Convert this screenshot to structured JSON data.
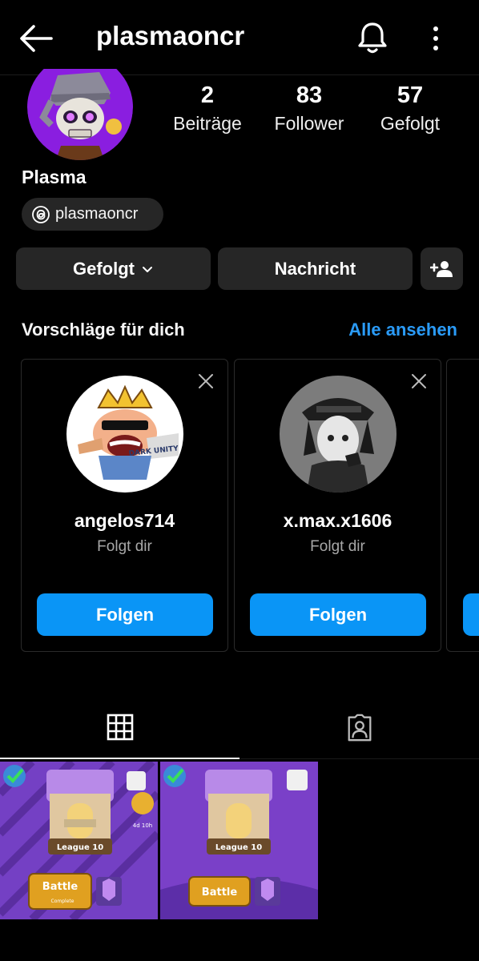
{
  "header": {
    "username": "plasmaoncr",
    "back_icon": "arrow-left-icon",
    "bell_icon": "bell-icon",
    "more_icon": "more-vertical-icon"
  },
  "profile": {
    "display_name": "Plasma",
    "threads_handle": "plasmaoncr",
    "stats": [
      {
        "value": "2",
        "label": "Beiträge"
      },
      {
        "value": "83",
        "label": "Follower"
      },
      {
        "value": "57",
        "label": "Gefolgt"
      }
    ]
  },
  "actions": {
    "following_label": "Gefolgt",
    "message_label": "Nachricht",
    "add_person_icon": "add-person-icon"
  },
  "suggestions": {
    "title": "Vorschläge für dich",
    "see_all": "Alle ansehen",
    "cards": [
      {
        "username": "angelos714",
        "subtitle": "Folgt dir",
        "button": "Folgen",
        "avatar_text": "DARK UNITY"
      },
      {
        "username": "x.max.x1606",
        "subtitle": "Folgt dir",
        "button": "Folgen"
      }
    ]
  },
  "tabs": [
    {
      "icon": "grid-icon",
      "active": true
    },
    {
      "icon": "tagged-person-icon",
      "active": false
    }
  ],
  "posts": [
    {
      "league": "League 10",
      "battle": "Battle",
      "complete": "Complete",
      "timer": "4d 10h"
    },
    {
      "league": "League 10",
      "battle": "Battle"
    }
  ],
  "colors": {
    "background": "#000000",
    "button_dark": "#262626",
    "accent_blue": "#0a95f6",
    "link_blue": "#2a9bf8",
    "muted_text": "#a8a8a8",
    "avatar_purple": "#8a1ee0"
  }
}
